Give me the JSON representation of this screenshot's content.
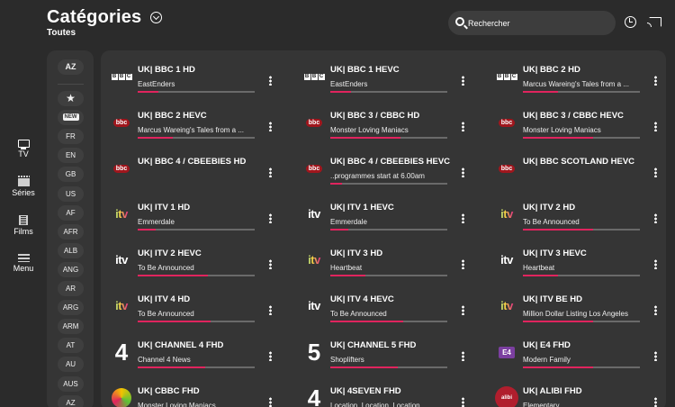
{
  "header": {
    "title": "Catégories",
    "subtitle": "Toutes",
    "search_placeholder": "Rechercher"
  },
  "nav": [
    {
      "label": "TV",
      "icon": "tv-icon",
      "active": true
    },
    {
      "label": "Séries",
      "icon": "series-icon"
    },
    {
      "label": "Films",
      "icon": "films-icon"
    },
    {
      "label": "Menu",
      "icon": "menu-icon"
    }
  ],
  "filters": {
    "sort_label": "AZ",
    "chips": [
      "★",
      "NEW",
      "FR",
      "EN",
      "GB",
      "US",
      "AF",
      "AFR",
      "ALB",
      "ANG",
      "AR",
      "ARG",
      "ARM",
      "AT",
      "AU",
      "AUS",
      "AZ"
    ]
  },
  "accent_color": "#e0245e",
  "channels": [
    {
      "name": "UK| BBC 1 HD",
      "program": "EastEnders",
      "progress": 0.18,
      "logo": "bbc-logo"
    },
    {
      "name": "UK| BBC 1 HEVC",
      "program": "EastEnders",
      "progress": 0.18,
      "logo": "bbc-logo"
    },
    {
      "name": "UK| BBC 2 HD",
      "program": "Marcus Wareing's Tales from a ...",
      "progress": 0.3,
      "logo": "bbc-logo"
    },
    {
      "name": "UK| BBC 2 HEVC",
      "program": "Marcus Wareing's Tales from a ...",
      "progress": 0.3,
      "logo": "bbc-red-logo"
    },
    {
      "name": "UK| BBC 3 / CBBC HD",
      "program": "Monster Loving Maniacs",
      "progress": 0.6,
      "logo": "bbc-red-logo"
    },
    {
      "name": "UK| BBC 3 / CBBC HEVC",
      "program": "Monster Loving Maniacs",
      "progress": 0.6,
      "logo": "bbc-red-logo"
    },
    {
      "name": "UK| BBC 4 / CBEEBIES HD",
      "program": "",
      "progress": null,
      "logo": "bbc-red-logo"
    },
    {
      "name": "UK| BBC 4 / CBEEBIES HEVC",
      "program": "..programmes start at 6.00am",
      "progress": 0.1,
      "logo": "bbc-red-logo"
    },
    {
      "name": "UK| BBC SCOTLAND HEVC",
      "program": "",
      "progress": null,
      "logo": "bbc-red-logo"
    },
    {
      "name": "UK| ITV 1 HD",
      "program": "Emmerdale",
      "progress": 0.15,
      "logo": "itv-color-logo"
    },
    {
      "name": "UK| ITV 1 HEVC",
      "program": "Emmerdale",
      "progress": 0.15,
      "logo": "itv-logo"
    },
    {
      "name": "UK| ITV 2 HD",
      "program": "To Be Announced",
      "progress": 0.6,
      "logo": "itv-color-logo"
    },
    {
      "name": "UK| ITV 2 HEVC",
      "program": "To Be Announced",
      "progress": 0.6,
      "logo": "itv-logo"
    },
    {
      "name": "UK| ITV 3 HD",
      "program": "Heartbeat",
      "progress": 0.3,
      "logo": "itv-color-logo"
    },
    {
      "name": "UK| ITV 3 HEVC",
      "program": "Heartbeat",
      "progress": 0.3,
      "logo": "itv-logo"
    },
    {
      "name": "UK| ITV 4 HD",
      "program": "To Be Announced",
      "progress": 0.62,
      "logo": "itv-color-logo"
    },
    {
      "name": "UK| ITV 4 HEVC",
      "program": "To Be Announced",
      "progress": 0.62,
      "logo": "itv-logo"
    },
    {
      "name": "UK| ITV BE HD",
      "program": "Million Dollar Listing Los Angeles",
      "progress": 0.6,
      "logo": "itv-color-logo"
    },
    {
      "name": "UK| CHANNEL 4 FHD",
      "program": "Channel 4 News",
      "progress": 0.58,
      "logo": "channel4-logo"
    },
    {
      "name": "UK| CHANNEL 5 FHD",
      "program": "Shoplifters",
      "progress": 0.58,
      "logo": "channel5-logo"
    },
    {
      "name": "UK| E4 FHD",
      "program": "Modern Family",
      "progress": 0.6,
      "logo": "e4-logo"
    },
    {
      "name": "UK| CBBC FHD",
      "program": "Monster Loving Maniacs",
      "progress": 0.6,
      "logo": "cbbc-logo"
    },
    {
      "name": "UK| 4SEVEN FHD",
      "program": "Location, Location, Location",
      "progress": 0.2,
      "logo": "4seven-logo"
    },
    {
      "name": "UK| ALIBI FHD",
      "program": "Elementary",
      "progress": 0.2,
      "logo": "alibi-logo"
    }
  ]
}
